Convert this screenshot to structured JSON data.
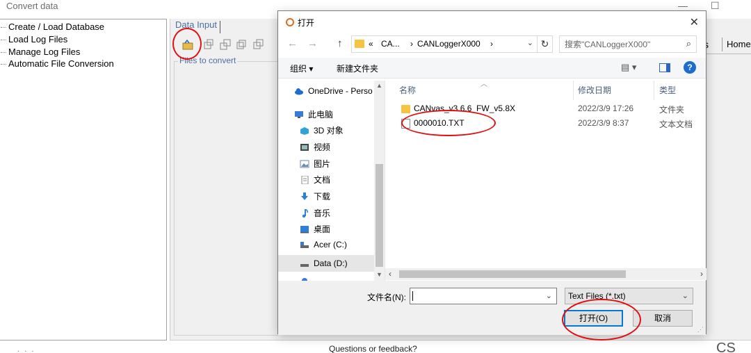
{
  "app": {
    "title": "Convert data",
    "minimize_glyph": "—",
    "maximize_glyph": "☐"
  },
  "left_nav": {
    "items": [
      {
        "label": "Create / Load Database"
      },
      {
        "label": "Load Log Files"
      },
      {
        "label": "Manage Log Files"
      },
      {
        "label": "Automatic File Conversion"
      }
    ]
  },
  "right_pane": {
    "tab_label": "Data Input",
    "group_label": "Files to convert",
    "edge_label": "s",
    "home_tab": "Home",
    "toolbar_icons": [
      "open-file-icon",
      "toolbar-icon-2",
      "toolbar-icon-3",
      "toolbar-icon-4",
      "toolbar-icon-5"
    ]
  },
  "footer": {
    "feedback": "Questions or feedback?",
    "logo_text": "CS",
    "dots": "· · ·"
  },
  "dialog": {
    "title": "打开",
    "close_glyph": "✕",
    "nav": {
      "back_glyph": "←",
      "forward_glyph": "→",
      "up_glyph": "↑",
      "breadcrumb_prefix": "«",
      "path": [
        "CA...",
        "CANLoggerX000"
      ],
      "refresh_glyph": "↻"
    },
    "search": {
      "placeholder": "搜索\"CANLoggerX000\""
    },
    "commands": {
      "organize": "组织 ▾",
      "new_folder": "新建文件夹",
      "view_glyph": "▤ ▾",
      "help_glyph": "?"
    },
    "tree": [
      {
        "label": "OneDrive - Perso",
        "icon": "cloud-icon",
        "color": "#1e6cd0"
      },
      {
        "label": "此电脑",
        "icon": "computer-icon",
        "color": "#3a7bd5"
      },
      {
        "label": "3D 对象",
        "icon": "3d-objects-icon",
        "color": "#2fa3d6"
      },
      {
        "label": "视频",
        "icon": "video-icon",
        "color": "#444"
      },
      {
        "label": "图片",
        "icon": "pictures-icon",
        "color": "#6a8ab0"
      },
      {
        "label": "文档",
        "icon": "documents-icon",
        "color": "#8a8a8a"
      },
      {
        "label": "下载",
        "icon": "download-icon",
        "color": "#2e7fd8"
      },
      {
        "label": "音乐",
        "icon": "music-icon",
        "color": "#2e7fd8"
      },
      {
        "label": "桌面",
        "icon": "desktop-icon",
        "color": "#2e7fd8"
      },
      {
        "label": "Acer (C:)",
        "icon": "drive-c-icon",
        "color": "#555"
      },
      {
        "label": "Data (D:)",
        "icon": "drive-d-icon",
        "color": "#555"
      }
    ],
    "columns": [
      "名称",
      "修改日期",
      "类型"
    ],
    "files": [
      {
        "name": "CANvas_v3.6.6_FW_v5.8X",
        "date": "2022/3/9 17:26",
        "type": "文件夹",
        "icon": "folder-icon"
      },
      {
        "name": "0000010.TXT",
        "date": "2022/3/9 8:37",
        "type": "文本文档",
        "icon": "text-file-icon"
      }
    ],
    "file_name_label": "文件名(N):",
    "file_name_value": "",
    "file_type_value": "Text Files (*.txt)",
    "open_button": "打开(O)",
    "cancel_button": "取消"
  },
  "annotation_color": "#e01010"
}
